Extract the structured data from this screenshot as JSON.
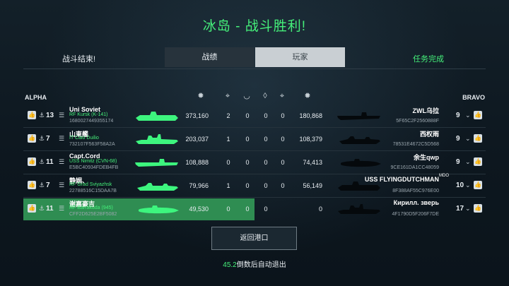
{
  "title": "冰岛 - 战斗胜利!",
  "header": {
    "left": "战斗结束!",
    "tab_stats": "战绩",
    "tab_players": "玩家",
    "right": "任务完成"
  },
  "teams": {
    "alpha": "ALPHA",
    "bravo": "BRAVO"
  },
  "alpha": [
    {
      "rank": "13",
      "name": "Uni Soviet",
      "ship": "RF Kursk (K-141)",
      "id": "1680027449355174",
      "damage": "373,160",
      "c1": "2",
      "c2": "0",
      "c3": "0",
      "c4": "0",
      "total": "180,868"
    },
    {
      "rank": "7",
      "name": "山東艦",
      "ship": "IT Caio Duilio",
      "id": "732107F563F58A2A",
      "damage": "203,037",
      "c1": "1",
      "c2": "0",
      "c3": "0",
      "c4": "0",
      "total": "108,379"
    },
    {
      "rank": "11",
      "name": "Capt.Cord",
      "ship": "USS Nimitz (CVN-68)",
      "id": "E5BC40934FDEB4FB",
      "damage": "108,888",
      "c1": "0",
      "c2": "0",
      "c3": "0",
      "c4": "0",
      "total": "74,413"
    },
    {
      "rank": "7",
      "name": "静姻、",
      "ship": "RF Grad Sviyazhsk",
      "id": "22788516C15DAA7B",
      "damage": "79,966",
      "c1": "1",
      "c2": "0",
      "c3": "0",
      "c4": "0",
      "total": "56,149"
    },
    {
      "rank": "11",
      "name": "谢嘉豪吉",
      "ship": "RF Barrakuda (945)",
      "id": "CFF2D625E2BF5082",
      "damage": "49,530",
      "c1": "0",
      "c2": "0",
      "c3": "0",
      "c4": "",
      "total": "0"
    }
  ],
  "bravo": [
    {
      "rank": "9",
      "name": "ZWL乌拉",
      "id": "5F65C2F2560888F"
    },
    {
      "rank": "9",
      "name": "西权雨",
      "id": "78531E4672C5D568"
    },
    {
      "rank": "9",
      "name": "余生qwp",
      "id": "9CE161DA1CC48059"
    },
    {
      "rank": "10",
      "name": "USS FLYINGDUTCHMAN",
      "sup": "MDO",
      "id": "8F388AF55C976E00"
    },
    {
      "rank": "17",
      "name": "Кирилл. зверь",
      "id": "4F1790D5F206F7DE"
    }
  ],
  "return_button": "返回港口",
  "countdown": {
    "value": "45.2",
    "text": "倒数后自动退出"
  },
  "colors": {
    "accent": "#45f07a",
    "highlight_row": "#2f8d52"
  }
}
